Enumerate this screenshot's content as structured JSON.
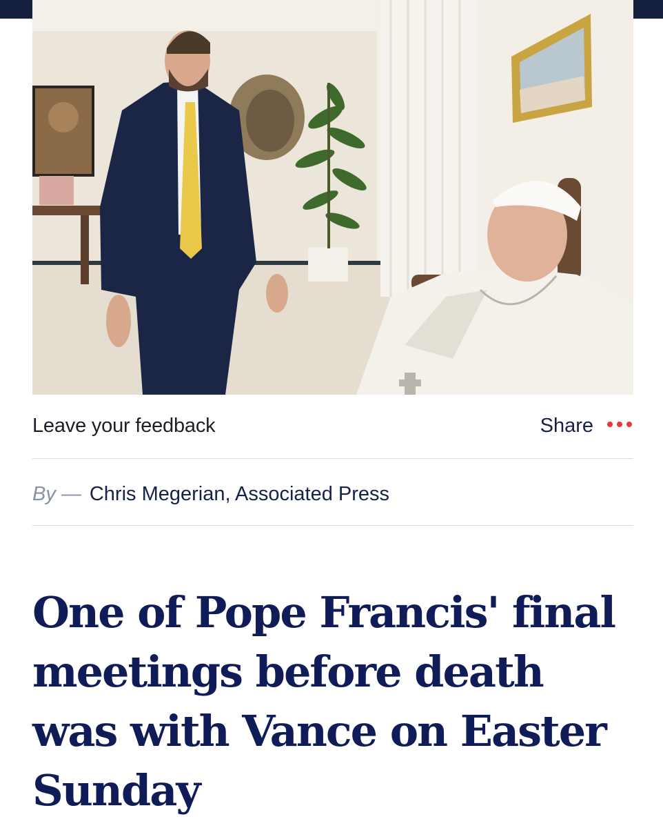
{
  "article": {
    "image": {
      "alt": "",
      "colors": {
        "wall": "#eee9df",
        "suit": "#1b2647",
        "tie": "#e9c84a",
        "cassock": "#f4f1ea",
        "plant": "#3e6b2c",
        "frame": "#c9a442"
      }
    },
    "actions": {
      "feedback_label": "Leave your feedback",
      "share_label": "Share",
      "more_icon": "more-dots-icon"
    },
    "byline": {
      "prefix": "By",
      "dash": "—",
      "author": "Chris Megerian, Associated Press"
    },
    "headline": "One of Pope Francis' final meetings before death was with Vance on Easter Sunday"
  },
  "colors": {
    "headline": "#101c57",
    "accent_dots": "#e43a3a",
    "topbar": "#16203f"
  }
}
